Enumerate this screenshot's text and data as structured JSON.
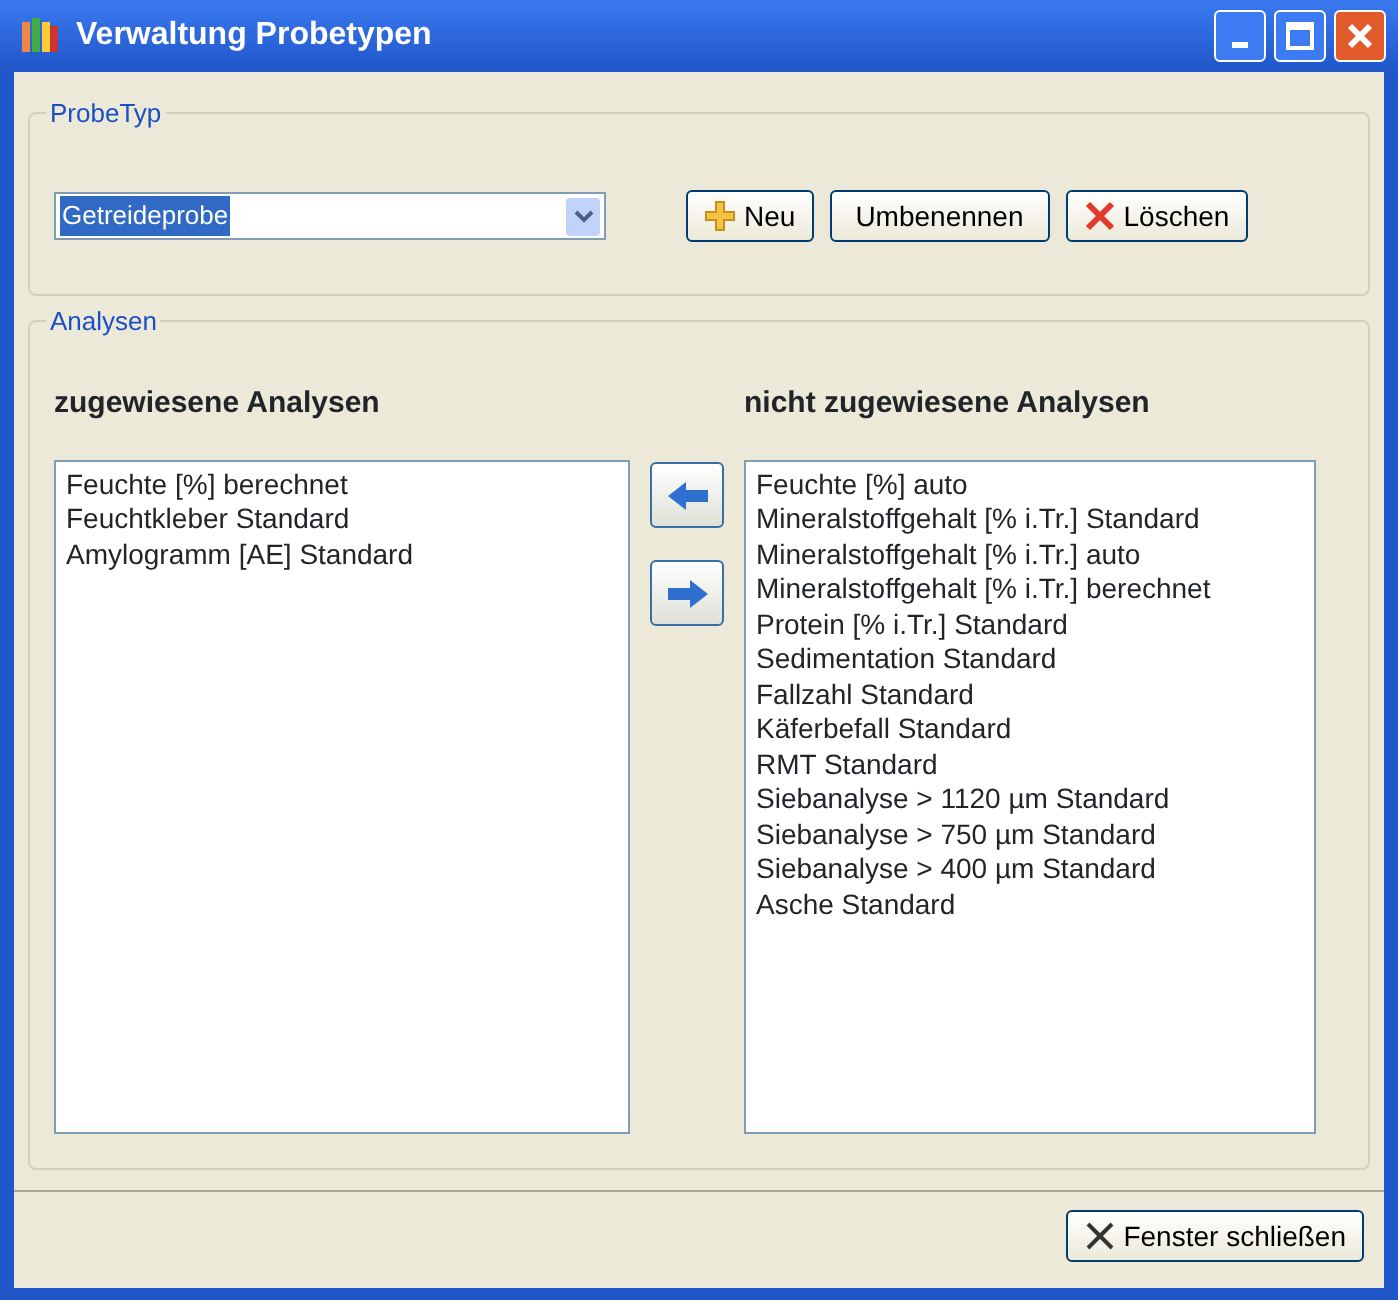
{
  "window": {
    "title": "Verwaltung Probetypen"
  },
  "probetyp_group": {
    "legend": "ProbeTyp",
    "combo_value": "Getreideprobe",
    "buttons": [
      {
        "label": "Neu",
        "kind": "add"
      },
      {
        "label": "Umbenennen",
        "kind": "plain"
      },
      {
        "label": "Löschen",
        "kind": "delete"
      }
    ]
  },
  "analysen_group": {
    "legend": "Analysen",
    "assigned": {
      "heading": "zugewiesene Analysen",
      "items": [
        "Feuchte [%] berechnet",
        "Feuchtkleber Standard",
        "Amylogramm [AE] Standard"
      ]
    },
    "unassigned": {
      "heading": "nicht zugewiesene Analysen",
      "items": [
        "Feuchte [%] auto",
        "Mineralstoffgehalt [% i.Tr.] Standard",
        "Mineralstoffgehalt [% i.Tr.] auto",
        "Mineralstoffgehalt [% i.Tr.] berechnet",
        "Protein [% i.Tr.] Standard",
        "Sedimentation Standard",
        "Fallzahl Standard",
        "Käferbefall Standard",
        "RMT Standard",
        "Siebanalyse > 1120 µm Standard",
        "Siebanalyse > 750 µm Standard",
        "Siebanalyse > 400 µm Standard",
        "Asche Standard"
      ]
    }
  },
  "close_button": {
    "label": "Fenster schließen"
  }
}
